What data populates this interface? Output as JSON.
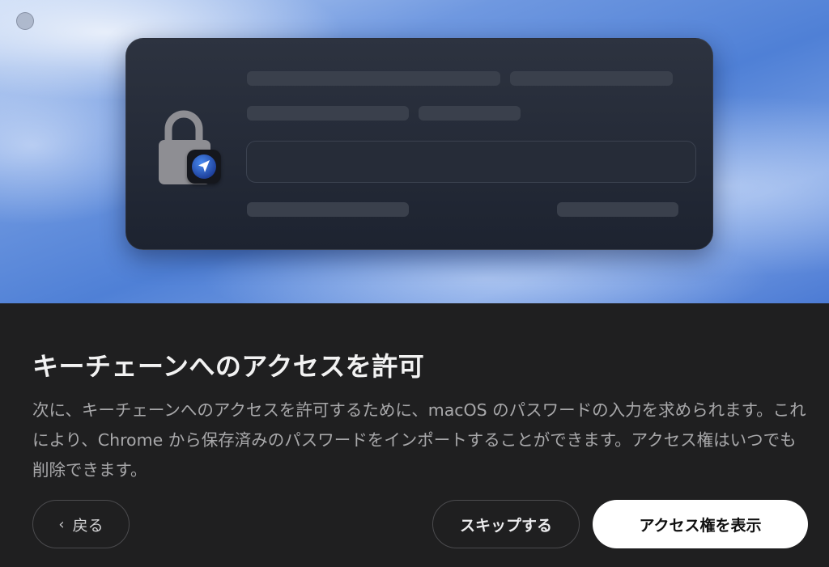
{
  "onboarding": {
    "title": "キーチェーンへのアクセスを許可",
    "description": "次に、キーチェーンへのアクセスを許可するために、macOS のパスワードの入力を求められます。これにより、Chrome から保存済みのパスワードをインポートすることができます。アクセス権はいつでも削除できます。",
    "buttons": {
      "back_label": "戻る",
      "skip_label": "スキップする",
      "primary_label": "アクセス権を表示"
    }
  },
  "icons": {
    "lock": "lock-icon",
    "app_badge": "navigation-arrow-icon",
    "back": "chevron-left-icon",
    "window_control": "window-close-dot-icon"
  },
  "colors": {
    "panel_background": "#1f1f20",
    "title_text": "#f2f2f2",
    "description_text": "#a8a8aa",
    "primary_button_bg": "#ffffff",
    "primary_button_text": "#111111",
    "hero_blue": "#4f80d6",
    "badge_blue": "#2d6fe0"
  }
}
